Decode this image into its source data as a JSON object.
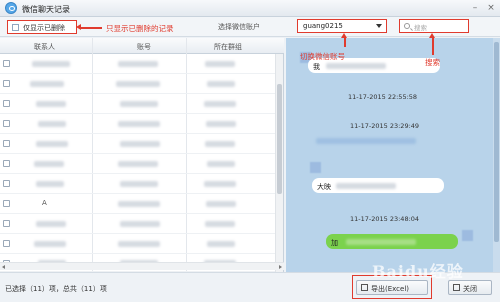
{
  "window": {
    "title": "微信聊天记录"
  },
  "toolbar": {
    "deleted_only_label": "仅显示已删除",
    "select_account_label": "选择微信账户",
    "account_value": "guang0215",
    "search_placeholder": "搜索"
  },
  "annotations": {
    "deleted_only": "只显示已删除的记录",
    "switch_account": "切换微信账号",
    "search": "搜索"
  },
  "table": {
    "columns": [
      "联系人",
      "账号",
      "所在群组"
    ],
    "rows": [
      {
        "contact_char": ""
      },
      {
        "contact_char": ""
      },
      {
        "contact_char": ""
      },
      {
        "contact_char": ""
      },
      {
        "contact_char": ""
      },
      {
        "contact_char": ""
      },
      {
        "contact_char": ""
      },
      {
        "contact_char": "A"
      },
      {
        "contact_char": ""
      },
      {
        "contact_char": ""
      },
      {
        "contact_char": ""
      }
    ]
  },
  "chat": {
    "messages": [
      {
        "text": "我",
        "style": "white"
      },
      {
        "timestamp": "11-17-2015 22:55:58"
      },
      {
        "timestamp": "11-17-2015 23:29:49"
      },
      {
        "text": "大映",
        "style": "white"
      },
      {
        "timestamp": "11-17-2015 23:48:04"
      },
      {
        "text": "加",
        "style": "green"
      }
    ]
  },
  "status": {
    "text": "已选择（11）项，总共（11）项",
    "export_label": "导出(Excel)",
    "close_label": "关闭"
  },
  "watermark": "Baidu经验",
  "colors": {
    "annotation_red": "#e03b2e",
    "chat_bg": "#b8d3ea",
    "bubble_green": "#7bd24d"
  }
}
